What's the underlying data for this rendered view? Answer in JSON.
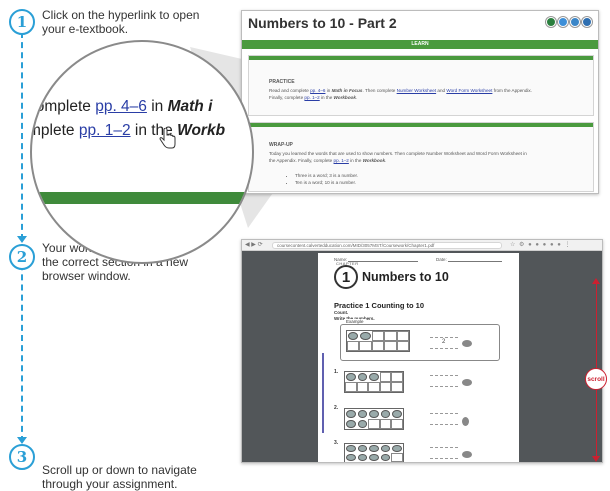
{
  "steps": [
    {
      "number": "1",
      "line1": "Click on the hyperlink to open",
      "line2": "your e-textbook."
    },
    {
      "number": "2",
      "line1": "Your workbook will open to",
      "line2": "the correct section in a new",
      "line3": "browser window."
    },
    {
      "number": "3",
      "line1": "Scroll up or down to navigate",
      "line2": "through your assignment."
    }
  ],
  "magnifier": {
    "line1_pre": "complete ",
    "line1_link": "pp. 4–6",
    "line1_mid": " in ",
    "line1_bold": "Math i",
    "line2_pre": "mplete ",
    "line2_link": "pp. 1–2",
    "line2_mid": " in the ",
    "line2_bold": "Workb"
  },
  "course_page": {
    "title": "Numbers to 10 - Part 2",
    "icon_colors": [
      "#2a7f3e",
      "#3d8fd8",
      "#3b86c8",
      "#2f6fb1"
    ],
    "section_bar": "LEARN",
    "practice": {
      "heading": "PRACTICE",
      "text_1": "Read and complete ",
      "link_1": "pp. 4–6",
      "text_2": " in ",
      "bold_1": "Math in Focus",
      "text_3": ". Then complete ",
      "link_2": "Number Worksheet",
      "text_4": " and ",
      "link_3": "Word Form Worksheet",
      "text_5": " from the Appendix.",
      "text_6": "Finally, complete ",
      "link_4": "pp. 1–2",
      "text_7": " in the ",
      "bold_2": "Workbook",
      "text_8": "."
    },
    "wrapup": {
      "heading": "WRAP-UP",
      "text_1": "Today you learned the words that are used to show numbers. Then complete Number Worksheet and Word Form Worksheet in",
      "text_2": "the Appendix. Finally, complete ",
      "link": "pp. 1–2",
      "text_3": " in the ",
      "bold": "Workbook",
      "text_4": ".",
      "bullets": [
        "Three is a word; 3 is a number.",
        "Ten is a word; 10 is a number."
      ]
    }
  },
  "pdf_viewer": {
    "url": "coursecontent.calvertedducation.com/MID/3057MST/Coursework/Chapter1.pdf",
    "page": {
      "name_label": "Name:",
      "date_label": "Date:",
      "chapter_word": "CHAPTER",
      "chapter_number": "1",
      "chapter_title": "Numbers to 10",
      "practice_title": "Practice 1   Counting to 10",
      "instruction_1": "Count.",
      "instruction_2": "Write the numbers.",
      "example_label": "Example",
      "example_answer": "2",
      "questions": [
        "1.",
        "2.",
        "3."
      ]
    }
  },
  "scroll_label": "scroll",
  "colors": {
    "step_blue": "#2a9fd6",
    "green_bar": "#4a9a3e",
    "scroll_red": "#cc2030"
  }
}
